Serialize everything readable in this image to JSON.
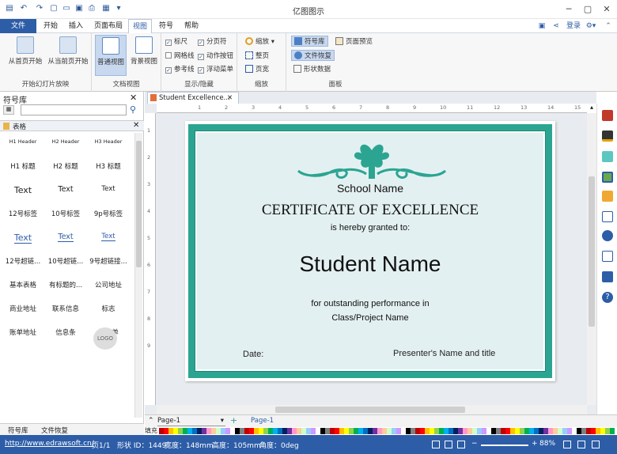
{
  "app": {
    "title": "亿图图示"
  },
  "menu": {
    "tabs": [
      "文件",
      "开始",
      "插入",
      "页面布局",
      "视图",
      "符号",
      "帮助"
    ],
    "login": "登录",
    "active": "视图"
  },
  "ribbon": {
    "slideshow": {
      "from_first": "从首页开始",
      "from_current": "从当前页开始",
      "group": "开始幻灯片放映"
    },
    "docview": {
      "normal": "普通视图",
      "background": "背景视图",
      "group": "文档视图"
    },
    "showhide": {
      "ruler": "标尺",
      "pagebreak": "分页符",
      "grid": "网格线",
      "actionbtn": "动作按钮",
      "guides": "参考线",
      "floatmenu": "浮动菜单",
      "group": "显示/隐藏"
    },
    "zoom": {
      "zoom": "缩放",
      "fitpage": "整页",
      "fitwidth": "页宽",
      "group": "缩放"
    },
    "panel": {
      "symbols": "符号库",
      "pagepreview": "页面预览",
      "recovery": "文件恢复",
      "shapedata": "形状数据",
      "group": "面板"
    }
  },
  "library": {
    "title": "符号库",
    "category": "表格",
    "search_placeholder": "",
    "items": [
      {
        "label": "H1 Header",
        "style": "h"
      },
      {
        "label": "H2 Header",
        "style": "h"
      },
      {
        "label": "H3 Header",
        "style": "h"
      },
      {
        "label": "H1 标题",
        "style": "t"
      },
      {
        "label": "H2 标题",
        "style": "t"
      },
      {
        "label": "H3 标题",
        "style": "t"
      },
      {
        "label": "Text",
        "style": "big"
      },
      {
        "label": "Text",
        "style": "mid"
      },
      {
        "label": "Text",
        "style": "sm"
      },
      {
        "label": "12号标签",
        "style": "t"
      },
      {
        "label": "10号标签",
        "style": "t"
      },
      {
        "label": "9p号标签",
        "style": "t"
      },
      {
        "label": "Text",
        "style": "link1"
      },
      {
        "label": "Text",
        "style": "link2"
      },
      {
        "label": "Text",
        "style": "link3"
      },
      {
        "label": "12号超链...",
        "style": "t"
      },
      {
        "label": "10号超链...",
        "style": "t"
      },
      {
        "label": "9号超链接...",
        "style": "t"
      },
      {
        "label": "基本表格",
        "style": "t"
      },
      {
        "label": "有标题的...",
        "style": "t"
      },
      {
        "label": "公司地址",
        "style": "t"
      },
      {
        "label": "商业地址",
        "style": "t"
      },
      {
        "label": "联系信息",
        "style": "t"
      },
      {
        "label": "标志",
        "style": "t"
      },
      {
        "label": "账单地址",
        "style": "t"
      },
      {
        "label": "信息条",
        "style": "t"
      },
      {
        "label": "报价单",
        "style": "t"
      }
    ],
    "logo_text": "LOGO",
    "bottom_tabs": [
      "符号库",
      "文件恢复"
    ]
  },
  "document": {
    "tab": "Student Excellence...",
    "page_select": "Page-1",
    "page_tab": "Page-1",
    "fill_label": "填充"
  },
  "certificate": {
    "school": "School Name",
    "heading": "CERTIFICATE OF EXCELLENCE",
    "granted": "is hereby granted to:",
    "student": "Student Name",
    "reason": "for outstanding performance in",
    "course": "Class/Project Name",
    "date": "Date:",
    "presenter": "Presenter's Name and title",
    "accent": "#2ba592"
  },
  "ruler": {
    "h": [
      "1",
      "2",
      "3",
      "4",
      "5",
      "6",
      "7",
      "8",
      "9",
      "10",
      "11",
      "12",
      "13",
      "14",
      "15"
    ],
    "v": [
      "1",
      "2",
      "3",
      "4",
      "5",
      "6",
      "7",
      "8",
      "9"
    ]
  },
  "status": {
    "url": "http://www.edrawsoft.cn/",
    "page": "页1/1",
    "shape_id": "形状 ID：1449",
    "width": "宽度：148mm",
    "height": "高度：105mm",
    "angle": "角度：0deg",
    "zoom": "88%"
  },
  "palette": [
    "#c00000",
    "#ff0000",
    "#ffc000",
    "#ffff00",
    "#92d050",
    "#00b050",
    "#00b0f0",
    "#0070c0",
    "#002060",
    "#7030a0",
    "#ff99cc",
    "#ffcc99",
    "#ccffcc",
    "#99ccff",
    "#cc99ff",
    "#ffffff",
    "#000000",
    "#808080"
  ]
}
